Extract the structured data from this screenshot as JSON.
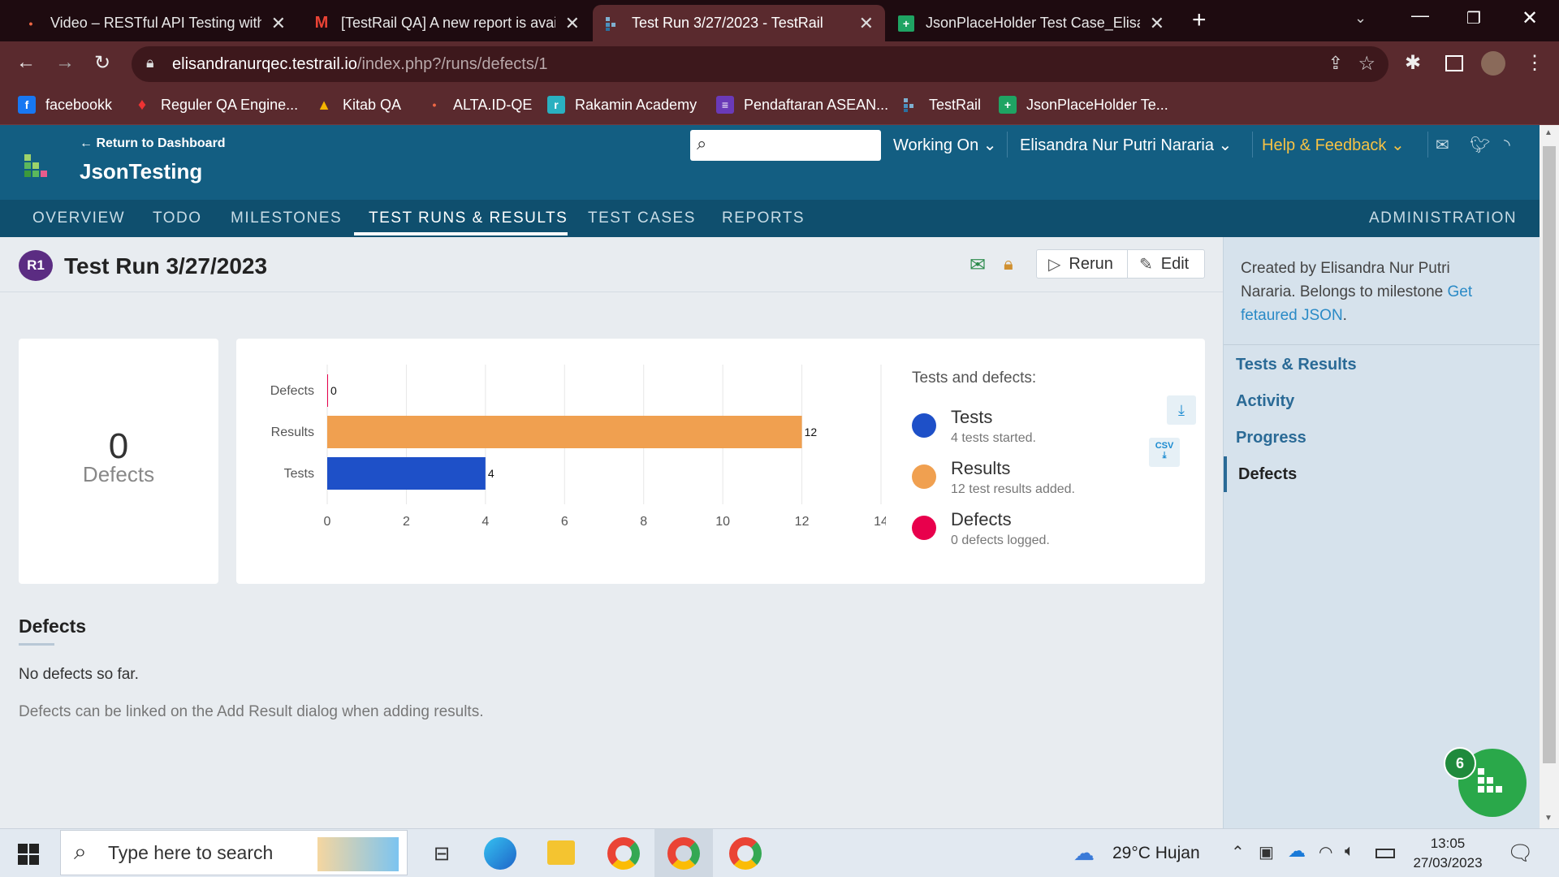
{
  "browser": {
    "tabs": [
      {
        "title": "Video – RESTful API Testing with I",
        "icon": "video-favicon"
      },
      {
        "title": "[TestRail QA] A new report is avai",
        "icon": "gmail-favicon"
      },
      {
        "title": "Test Run 3/27/2023 - TestRail",
        "icon": "testrail-favicon"
      },
      {
        "title": "JsonPlaceHolder Test Case_Elisan",
        "icon": "sheets-favicon"
      }
    ],
    "url_domain": "elisandranurqec.testrail.io",
    "url_path": "/index.php?/runs/defects/1",
    "bookmarks": [
      "facebookk",
      "Reguler QA Engine...",
      "Kitab QA",
      "ALTA.ID-QE",
      "Rakamin Academy",
      "Pendaftaran ASEAN...",
      "TestRail",
      "JsonPlaceHolder Te..."
    ]
  },
  "header": {
    "return_link": "← Return to Dashboard",
    "project": "JsonTesting",
    "working_on": "Working On",
    "user": "Elisandra Nur Putri Nararia",
    "help": "Help & Feedback",
    "nav": [
      "OVERVIEW",
      "TODO",
      "MILESTONES",
      "TEST RUNS & RESULTS",
      "TEST CASES",
      "REPORTS"
    ],
    "admin": "ADMINISTRATION"
  },
  "run": {
    "badge": "R1",
    "title": "Test Run 3/27/2023",
    "rerun": "Rerun",
    "edit": "Edit"
  },
  "summary": {
    "count": "0",
    "label": "Defects"
  },
  "chart_data": {
    "type": "bar",
    "orientation": "horizontal",
    "categories": [
      "Defects",
      "Results",
      "Tests"
    ],
    "values": [
      0,
      12,
      4
    ],
    "colors": [
      "#e8004c",
      "#f0a050",
      "#1e50c8"
    ],
    "xlim": [
      0,
      14
    ],
    "xticks": [
      0,
      2,
      4,
      6,
      8,
      10,
      12,
      14
    ],
    "grid": true
  },
  "legend": {
    "title": "Tests and defects:",
    "items": [
      {
        "name": "Tests",
        "desc": "4 tests started.",
        "color": "#1e50c8"
      },
      {
        "name": "Results",
        "desc": "12 test results added.",
        "color": "#f0a050"
      },
      {
        "name": "Defects",
        "desc": "0 defects logged.",
        "color": "#e8004c"
      }
    ],
    "csv": "CSV"
  },
  "defects_section": {
    "heading": "Defects",
    "empty": "No defects so far.",
    "hint": "Defects can be linked on the Add Result dialog when adding results."
  },
  "sidebar": {
    "info_prefix": "Created by Elisandra Nur Putri Nararia. Belongs to milestone ",
    "milestone_link": "Get fetaured JSON",
    "info_suffix": ".",
    "links": [
      "Tests & Results",
      "Activity",
      "Progress",
      "Defects"
    ],
    "notification_count": "6"
  },
  "taskbar": {
    "search_placeholder": "Type here to search",
    "weather": "29°C  Hujan",
    "time": "13:05",
    "date": "27/03/2023"
  }
}
